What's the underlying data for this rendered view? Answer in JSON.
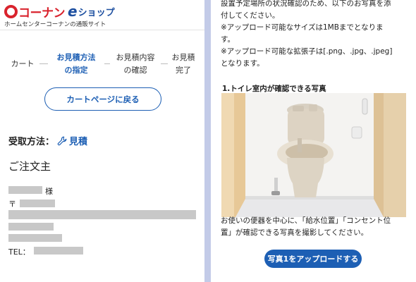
{
  "header": {
    "logo_text": "コーナン",
    "logo_e": "e",
    "logo_shop": "ショップ",
    "tagline": "ホームセンターコーナンの通販サイト"
  },
  "steps": [
    {
      "label": "カート",
      "active": false
    },
    {
      "label": "お見積方法の指定",
      "line1": "お見積方法",
      "line2": "の指定",
      "active": true
    },
    {
      "label": "お見積内容の確認",
      "line1": "お見積内容",
      "line2": "の確認",
      "active": false
    },
    {
      "label": "お見積完了",
      "line1": "お見積",
      "line2": "完了",
      "active": false
    }
  ],
  "cart_button": "カートページに戻る",
  "receive_method": {
    "label": "受取方法：",
    "value": "見積",
    "icon": "wrench-icon"
  },
  "orderer": {
    "heading": "ご注文主",
    "honorific": "様",
    "postal_mark": "〒",
    "tel_label": "TEL："
  },
  "instructions": {
    "line1": "設置予定場所の状況確認のため、以下のお写真を添",
    "line2": "付してください。",
    "line3": "※アップロード可能なサイズは1MBまでとなりま",
    "line4": "す。",
    "line5": "※アップロード可能な拡張子は[.png、.jpg、.jpeg]",
    "line6": "となります。"
  },
  "photo_section": {
    "title": "1.トイレ室内が確認できる写真",
    "caption_line1": "お使いの便器を中心に、「給水位置」「コンセント位",
    "caption_line2": "置」が確認できる写真を撮影してください。",
    "upload_button": "写真1をアップロードする"
  },
  "colors": {
    "brand_red": "#d9232d",
    "accent_blue": "#1d5fb4",
    "divider": "#c3cbe8"
  }
}
